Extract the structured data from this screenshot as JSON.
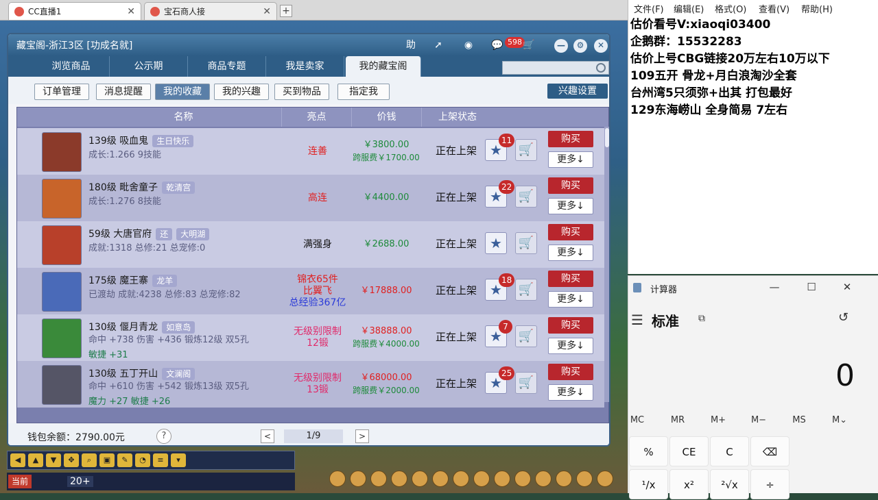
{
  "browser": {
    "tabs": [
      {
        "title": "CC直播1"
      },
      {
        "title": "宝石商人接"
      }
    ],
    "new_tab": "+"
  },
  "window": {
    "title": "藏宝阁-浙江3区 [功成名就]",
    "help": "助",
    "message_count": "598"
  },
  "nav": {
    "tabs": [
      "浏览商品",
      "公示期",
      "商品专题",
      "我是卖家",
      "我的藏宝阁"
    ],
    "active": "我的藏宝阁"
  },
  "subnav": {
    "buttons": [
      "订单管理",
      "消息提醒",
      "我的收藏",
      "我的兴趣",
      "买到物品",
      "指定我"
    ],
    "active": "我的收藏",
    "interest_settings": "兴趣设置"
  },
  "table": {
    "headers": [
      "名称",
      "亮点",
      "价钱",
      "上架状态"
    ],
    "rows": [
      {
        "level": "139级",
        "name": "吸血鬼",
        "tag": "生日快乐",
        "stats": "成长:1.266 9技能",
        "stats2": "",
        "highlight": [
          "连善"
        ],
        "hl_colors": [
          "#e02020"
        ],
        "price": "￥3800.00",
        "price_color": "#1d8a3a",
        "fee": "跨服费￥1700.00",
        "status": "正在上架",
        "fav": "11",
        "avatar_color": "#8b3a2a"
      },
      {
        "level": "180级",
        "name": "毗舍童子",
        "tag": "乾清宫",
        "stats": "成长:1.276 8技能",
        "stats2": "",
        "highlight": [
          "高连"
        ],
        "hl_colors": [
          "#e02020"
        ],
        "price": "￥4400.00",
        "price_color": "#1d8a3a",
        "fee": "",
        "status": "正在上架",
        "fav": "22",
        "avatar_color": "#c8642a"
      },
      {
        "level": "59级",
        "name": "大唐官府",
        "tag2": "还",
        "tag": "大明湖",
        "stats": "成就:1318 总修:21 总宠修:0",
        "stats2": "",
        "highlight": [
          "满强身"
        ],
        "hl_colors": [
          "#111111"
        ],
        "price": "￥2688.00",
        "price_color": "#1d8a3a",
        "fee": "",
        "status": "正在上架",
        "fav": "",
        "avatar_color": "#b8402a"
      },
      {
        "level": "175级",
        "name": "魔王寨",
        "tag": "龙羊",
        "stats": "已渡劫 成就:4238 总修:83 总宠修:82",
        "stats2": "",
        "highlight": [
          "锦衣65件",
          "比翼飞",
          "总经验367亿"
        ],
        "hl_colors": [
          "#e02020",
          "#e02020",
          "#2a3ad8"
        ],
        "price": "￥17888.00",
        "price_color": "#e02020",
        "fee": "",
        "status": "正在上架",
        "fav": "18",
        "avatar_color": "#4a6ab8"
      },
      {
        "level": "130级",
        "name": "偃月青龙",
        "tag": "如意岛",
        "stats": "命中 +738 伤害 +436 锻炼12级 双5孔",
        "stats2": "敏捷 +31",
        "highlight": [
          "无级别限制",
          "12锻"
        ],
        "hl_colors": [
          "#e02a6a",
          "#e02a6a"
        ],
        "price": "￥38888.00",
        "price_color": "#e02020",
        "fee": "跨服费￥4000.00",
        "status": "正在上架",
        "fav": "7",
        "avatar_color": "#3a8a3a"
      },
      {
        "level": "130级",
        "name": "五丁开山",
        "tag": "文澜阁",
        "stats": "命中 +610 伤害 +542 锻炼13级 双5孔",
        "stats2": "魔力 +27 敏捷 +26",
        "highlight": [
          "无级别限制",
          "13锻"
        ],
        "hl_colors": [
          "#e02a6a",
          "#e02a6a"
        ],
        "price": "￥68000.00",
        "price_color": "#e02020",
        "fee": "跨服费￥2000.00",
        "status": "正在上架",
        "fav": "25",
        "avatar_color": "#555566"
      }
    ],
    "buy_label": "购买",
    "more_label": "更多↓"
  },
  "footer": {
    "wallet": "钱包余额：2790.00元",
    "help": "?",
    "page": "1/9",
    "prev": "<",
    "next": ">"
  },
  "game_hud": {
    "chat_mode": "当前",
    "chat_count": "20+"
  },
  "notepad": {
    "menu": [
      "文件(F)",
      "编辑(E)",
      "格式(O)",
      "查看(V)",
      "帮助(H)"
    ],
    "lines": [
      "估价看号V:xiaoqi03400",
      "企鹅群：15532283",
      "估价上号CBG链接20万左右10万以下",
      "109五开 骨龙+月白浪淘沙全套",
      "台州湾5只须弥+出其 打包最好",
      "129东海崂山 全身简易  7左右"
    ]
  },
  "calculator": {
    "title": "计算器",
    "mode": "标准",
    "display": "0",
    "memory": [
      "MC",
      "MR",
      "M+",
      "M−",
      "MS",
      "M⌄"
    ],
    "keys": [
      "%",
      "CE",
      "C",
      "⌫",
      "¹/x",
      "x²",
      "²√x",
      "÷"
    ],
    "window_controls": [
      "—",
      "☐",
      "✕"
    ]
  }
}
